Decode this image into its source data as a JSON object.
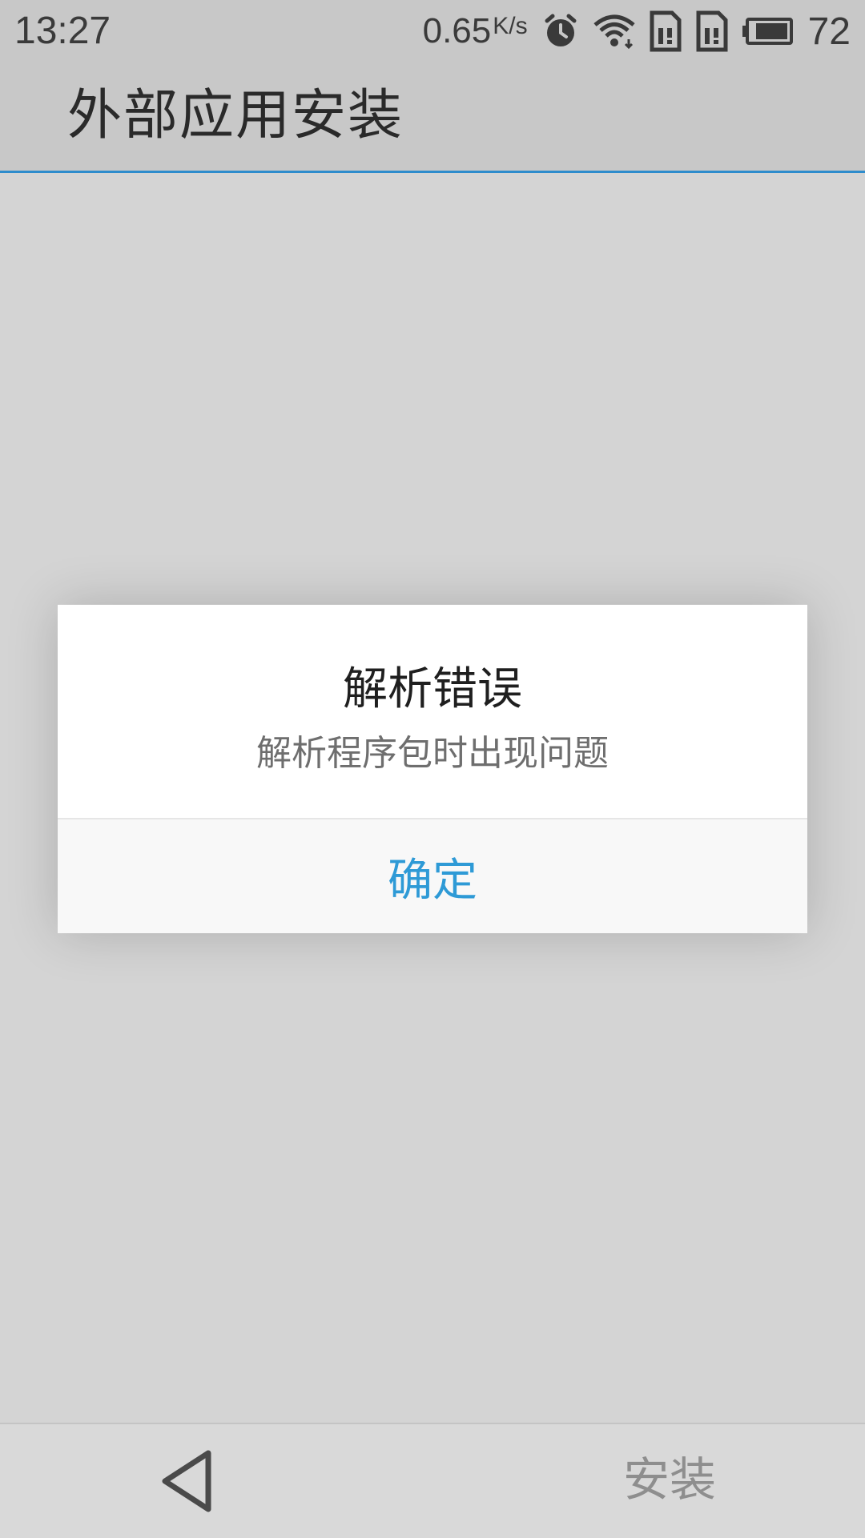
{
  "status_bar": {
    "time": "13:27",
    "net_speed": "0.65",
    "net_speed_unit": "K/s",
    "battery_level": "72",
    "icons": [
      "alarm-icon",
      "wifi-icon",
      "sim1-icon",
      "sim2-icon",
      "battery-icon"
    ]
  },
  "action_bar": {
    "title": "外部应用安装"
  },
  "dialog": {
    "title": "解析错误",
    "message": "解析程序包时出现问题",
    "confirm_label": "确定"
  },
  "bottom_bar": {
    "back_icon": "back-triangle-icon",
    "install_label": "安装"
  },
  "colors": {
    "accent": "#2e9ad6",
    "action_bar_divider": "#2e8ccc",
    "background": "#d4d4d4",
    "dialog_bg": "#ffffff",
    "dialog_button_bg": "#f8f8f8",
    "install_text": "#8e8e8e"
  }
}
